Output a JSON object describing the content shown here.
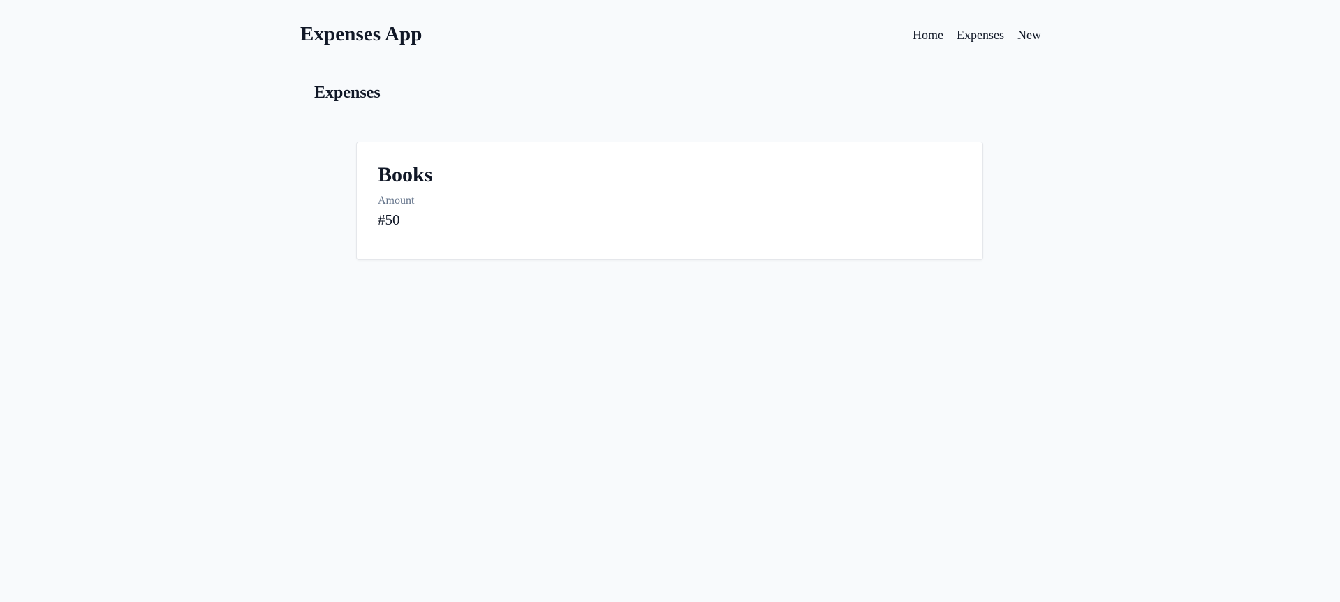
{
  "header": {
    "brand": "Expenses App",
    "nav": [
      {
        "label": "Home"
      },
      {
        "label": "Expenses"
      },
      {
        "label": "New"
      }
    ]
  },
  "main": {
    "title": "Expenses",
    "expenses": [
      {
        "name": "Books",
        "amount_label": "Amount",
        "amount": "#50"
      }
    ]
  },
  "colors": {
    "background": "#f8fafc",
    "text": "#111827",
    "muted": "#64748b",
    "card_border": "#e5e7eb"
  }
}
